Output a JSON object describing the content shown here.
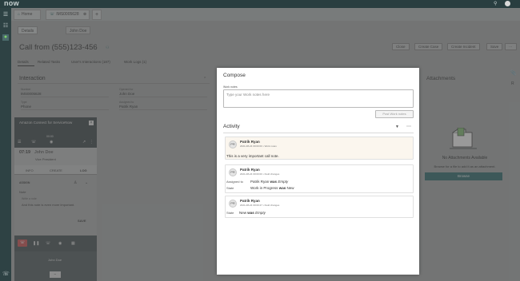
{
  "topbar": {
    "logo": "now"
  },
  "tabs": [
    {
      "label": "Home"
    },
    {
      "label": "IMS0005628"
    }
  ],
  "subtabs": [
    {
      "label": "Details"
    },
    {
      "label": "John Doe"
    }
  ],
  "record": {
    "title": "Call from (555)123-456",
    "actions": [
      "Close",
      "Create Case",
      "Create Incident",
      "Save"
    ],
    "related_tabs": [
      "Details",
      "Related Tasks",
      "User's Interactions (187)",
      "Work Logs (1)"
    ],
    "section": "Interaction",
    "fields": [
      {
        "label": "Number",
        "value": "IMS0005628"
      },
      {
        "label": "Opened for",
        "value": "John Doe"
      },
      {
        "label": "Type",
        "value": "Phone"
      },
      {
        "label": "Assigned to",
        "value": "Patrik Ryan"
      }
    ]
  },
  "agent_panel": {
    "title": "Amazon Connect for ServiceNow",
    "timer": "00:00",
    "call_time": "07:19",
    "caller": "John Doe",
    "caller_role": "Vice President",
    "tabs": [
      "INFO",
      "CREATE",
      "LOG"
    ],
    "section": "ASSIGN",
    "note_label": "Note",
    "note_sub": "Write a note",
    "note_text": "And this note is even more important.",
    "save": "SAVE",
    "bottom_caller": "John Doe"
  },
  "compose": {
    "title": "Compose",
    "work_notes_label": "Work notes",
    "placeholder": "Type your Work notes here",
    "post_button": "Post Work notes"
  },
  "activity": {
    "title": "Activity",
    "entries": [
      {
        "initials": "PR",
        "name": "Patrik Ryan",
        "meta": "2021-08-24 09:00:00 • Work notes",
        "text": "This is a very important call note."
      },
      {
        "initials": "PR",
        "name": "Patrik Ryan",
        "meta": "2021-08-24 09:00:00 • Field changes",
        "changes": [
          {
            "field": "Assigned to",
            "value": "Patrik Ryan",
            "was": "was",
            "old": "Empty"
          },
          {
            "field": "State",
            "value": "Work in Progress",
            "was": "was",
            "old": "New"
          }
        ]
      },
      {
        "initials": "PR",
        "name": "Patrik Ryan",
        "meta": "2021-08-24 09:00:47 • Field changes",
        "changes": [
          {
            "field": "State",
            "value": "New",
            "was": "was",
            "old": "Empty"
          }
        ]
      }
    ]
  },
  "attachments": {
    "title": "Attachments",
    "none": "No Attachments Available",
    "hint": "Browse for a file to add it as an attachment.",
    "browse": "Browse"
  }
}
